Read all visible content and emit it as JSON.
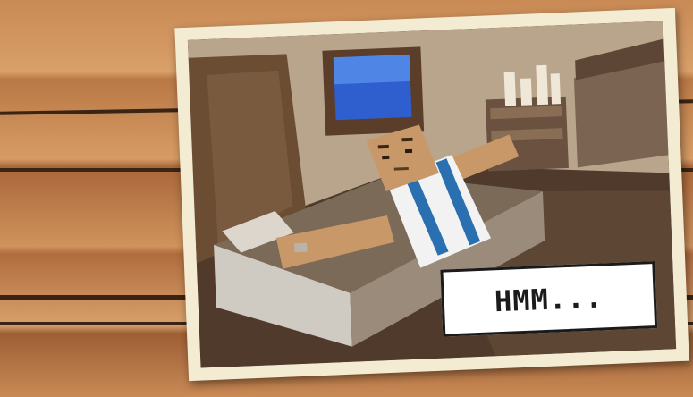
{
  "caption": {
    "text": "HMM..."
  },
  "colors": {
    "frame": "#f4ecd2",
    "wood": "#c98a55",
    "wall": "#b9a58c",
    "floor": "#4f3a2c",
    "bed": "#7b6a57",
    "shirt": "#f2f2f2",
    "stripe": "#2a6fb0",
    "skin": "#c89868"
  },
  "icons": {
    "tv": "tv-screen-icon",
    "candles": "candle-cluster-icon"
  }
}
